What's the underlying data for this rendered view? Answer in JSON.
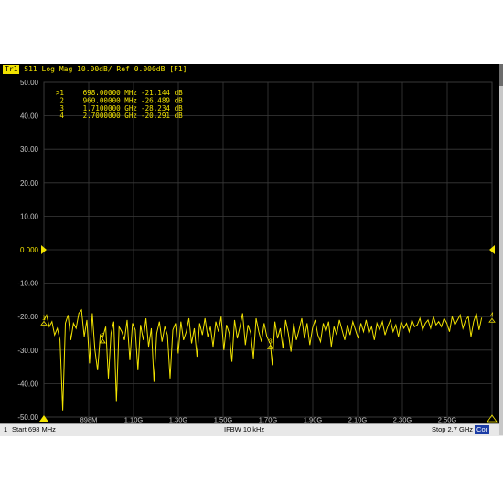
{
  "header": {
    "trace_tag": "Tr1",
    "title": "S11 Log Mag 10.00dB/ Ref 0.000dB [F1]"
  },
  "markers": [
    {
      "label": ">1",
      "freq": "698.00000 MHz",
      "value": "-21.144 dB"
    },
    {
      "label": "2",
      "freq": "960.00000 MHz",
      "value": "-26.489 dB"
    },
    {
      "label": "3",
      "freq": "1.7100000 GHz",
      "value": "-28.234 dB"
    },
    {
      "label": "4",
      "freq": "2.7000000 GHz",
      "value": "-20.291 dB"
    }
  ],
  "status": {
    "channel": "1",
    "start": "Start 698 MHz",
    "ifbw": "IFBW 10 kHz",
    "stop": "Stop 2.7 GHz",
    "cor": "Cor"
  },
  "chart_data": {
    "type": "line",
    "title": "S11 Log Mag 10.00dB/ Ref 0.000dB [F1]",
    "y_tick_labels": [
      "50.00",
      "40.00",
      "30.00",
      "20.00",
      "10.00",
      "0.000",
      "-10.00",
      "-20.00",
      "-30.00",
      "-40.00",
      "-50.00"
    ],
    "x_tick_labels": [
      "898M",
      "1.10G",
      "1.30G",
      "1.50G",
      "1.70G",
      "1.90G",
      "2.10G",
      "2.30G",
      "2.50G"
    ],
    "xlim": [
      698,
      2700
    ],
    "ylim": [
      -50,
      50
    ],
    "reference_level": 0,
    "grid": true,
    "colors": {
      "trace": "#f2e300",
      "grid": "#3a3a3a",
      "background": "#000000",
      "reference_label": "#f2e300",
      "axis_label": "#c8c8c8"
    },
    "series": [
      {
        "x_mhz": [
          698,
          710,
          722,
          734,
          746,
          758,
          770,
          782,
          794,
          806,
          818,
          830,
          842,
          854,
          866,
          878,
          890,
          902,
          914,
          926,
          938,
          950,
          960,
          974,
          986,
          998,
          1010,
          1022,
          1034,
          1046,
          1058,
          1070,
          1082,
          1094,
          1106,
          1118,
          1130,
          1142,
          1154,
          1166,
          1178,
          1190,
          1202,
          1214,
          1226,
          1238,
          1250,
          1262,
          1274,
          1286,
          1298,
          1310,
          1322,
          1334,
          1346,
          1358,
          1370,
          1382,
          1394,
          1406,
          1418,
          1430,
          1442,
          1454,
          1466,
          1478,
          1490,
          1502,
          1514,
          1526,
          1538,
          1550,
          1562,
          1574,
          1586,
          1598,
          1610,
          1622,
          1634,
          1646,
          1658,
          1670,
          1682,
          1694,
          1710,
          1718,
          1730,
          1742,
          1754,
          1766,
          1778,
          1790,
          1802,
          1814,
          1826,
          1838,
          1850,
          1862,
          1874,
          1886,
          1898,
          1910,
          1922,
          1934,
          1946,
          1958,
          1970,
          1982,
          1994,
          2006,
          2018,
          2030,
          2042,
          2054,
          2066,
          2078,
          2090,
          2102,
          2114,
          2126,
          2138,
          2150,
          2162,
          2174,
          2186,
          2198,
          2210,
          2222,
          2234,
          2246,
          2258,
          2270,
          2282,
          2294,
          2306,
          2318,
          2330,
          2342,
          2354,
          2366,
          2378,
          2390,
          2402,
          2414,
          2426,
          2438,
          2450,
          2462,
          2474,
          2486,
          2498,
          2510,
          2522,
          2534,
          2546,
          2558,
          2570,
          2582,
          2594,
          2606,
          2618,
          2630,
          2642,
          2654,
          2666,
          2678,
          2690,
          2700
        ],
        "s11_db": [
          -21.1,
          -19.5,
          -23.0,
          -21.5,
          -25.5,
          -23.5,
          -27.0,
          -48.0,
          -22.0,
          -19.5,
          -27.0,
          -22.0,
          -23.5,
          -19.0,
          -18.0,
          -26.0,
          -21.0,
          -34.0,
          -19.0,
          -30.0,
          -36.0,
          -25.5,
          -26.5,
          -23.0,
          -38.5,
          -25.0,
          -21.5,
          -45.5,
          -23.0,
          -24.5,
          -27.0,
          -21.0,
          -33.0,
          -22.0,
          -24.0,
          -36.0,
          -22.5,
          -27.0,
          -20.5,
          -29.0,
          -23.5,
          -39.5,
          -25.0,
          -21.5,
          -27.5,
          -23.0,
          -25.5,
          -38.5,
          -24.0,
          -22.0,
          -31.0,
          -21.5,
          -27.0,
          -24.5,
          -20.5,
          -28.0,
          -23.5,
          -32.0,
          -22.0,
          -25.5,
          -20.5,
          -26.0,
          -23.0,
          -29.0,
          -21.5,
          -24.5,
          -20.0,
          -30.0,
          -22.5,
          -25.0,
          -33.5,
          -21.0,
          -26.5,
          -23.0,
          -19.0,
          -28.5,
          -22.5,
          -25.0,
          -32.5,
          -20.5,
          -24.5,
          -27.5,
          -22.0,
          -26.0,
          -28.2,
          -34.5,
          -21.5,
          -26.5,
          -23.5,
          -29.5,
          -21.0,
          -25.0,
          -30.5,
          -22.0,
          -27.0,
          -24.0,
          -20.5,
          -26.5,
          -22.0,
          -28.5,
          -23.5,
          -21.0,
          -25.5,
          -27.5,
          -22.0,
          -24.5,
          -21.5,
          -29.0,
          -23.0,
          -25.5,
          -21.0,
          -24.0,
          -27.0,
          -22.5,
          -25.5,
          -21.5,
          -24.0,
          -26.5,
          -22.0,
          -24.5,
          -21.0,
          -25.0,
          -23.0,
          -27.0,
          -22.0,
          -24.0,
          -21.5,
          -25.5,
          -23.0,
          -21.0,
          -24.5,
          -22.5,
          -26.0,
          -21.5,
          -23.5,
          -22.0,
          -24.5,
          -21.0,
          -23.0,
          -22.5,
          -20.5,
          -24.0,
          -22.0,
          -21.0,
          -23.5,
          -20.0,
          -22.5,
          -21.5,
          -23.0,
          -20.5,
          -22.0,
          -24.5,
          -20.0,
          -22.5,
          -21.0,
          -19.5,
          -23.5,
          -21.0,
          -20.0,
          -26.0,
          -21.5,
          -19.0,
          -24.0,
          -20.3
        ]
      }
    ]
  }
}
